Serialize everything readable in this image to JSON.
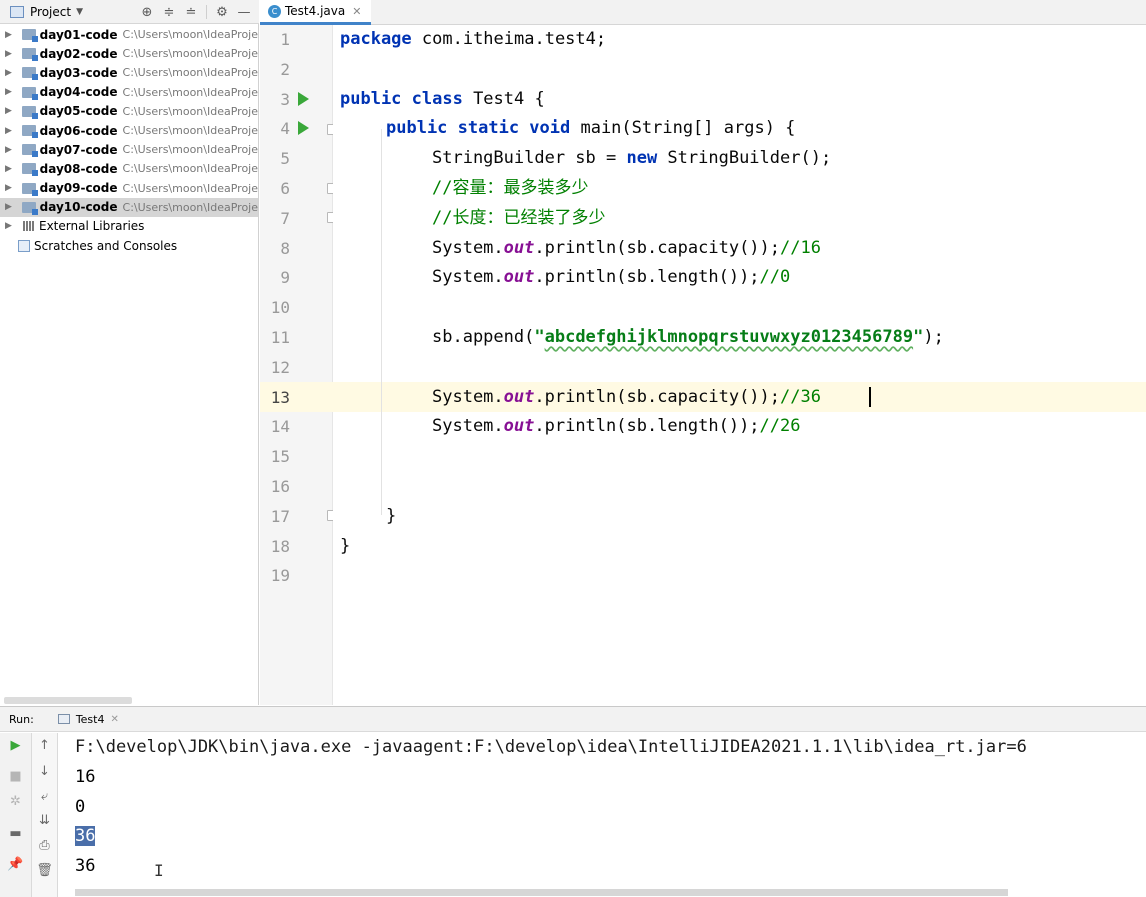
{
  "project_panel": {
    "title": "Project",
    "toolbar_icons": [
      "locate-icon",
      "expand-all-icon",
      "collapse-all-icon",
      "gear-icon",
      "hide-icon"
    ],
    "modules": [
      {
        "name": "day01-code",
        "path": "C:\\Users\\moon\\IdeaProje"
      },
      {
        "name": "day02-code",
        "path": "C:\\Users\\moon\\IdeaProje"
      },
      {
        "name": "day03-code",
        "path": "C:\\Users\\moon\\IdeaProje"
      },
      {
        "name": "day04-code",
        "path": "C:\\Users\\moon\\IdeaProje"
      },
      {
        "name": "day05-code",
        "path": "C:\\Users\\moon\\IdeaProje"
      },
      {
        "name": "day06-code",
        "path": "C:\\Users\\moon\\IdeaProje"
      },
      {
        "name": "day07-code",
        "path": "C:\\Users\\moon\\IdeaProje"
      },
      {
        "name": "day08-code",
        "path": "C:\\Users\\moon\\IdeaProje"
      },
      {
        "name": "day09-code",
        "path": "C:\\Users\\moon\\IdeaProje"
      },
      {
        "name": "day10-code",
        "path": "C:\\Users\\moon\\IdeaProje",
        "selected": true
      }
    ],
    "external_libraries": "External Libraries",
    "scratches": "Scratches and Consoles"
  },
  "editor": {
    "tab": "Test4.java",
    "line_numbers": [
      "1",
      "2",
      "3",
      "4",
      "5",
      "6",
      "7",
      "8",
      "9",
      "10",
      "11",
      "12",
      "13",
      "14",
      "15",
      "16",
      "17",
      "18",
      "19"
    ],
    "current_line": 13,
    "code": {
      "l1_kw": "package",
      "l1_rest": " com.itheima.test4;",
      "l3_kw": "public class",
      "l3_rest": " Test4 {",
      "l4_kw": "public static void",
      "l4_rest": " main(String[] args) {",
      "l5_a": "StringBuilder sb = ",
      "l5_kw": "new",
      "l5_b": " StringBuilder();",
      "l6": "//容量：最多装多少",
      "l7": "//长度：已经装了多少",
      "l8_a": "System.",
      "l8_out": "out",
      "l8_b": ".println(sb.capacity());",
      "l8_c": "//16",
      "l9_a": "System.",
      "l9_out": "out",
      "l9_b": ".println(sb.length());",
      "l9_c": "//0",
      "l11_a": "sb.append(",
      "l11_q1": "\"",
      "l11_str": "abcdefghijklmnopqrstuvwxyz0123456789",
      "l11_q2": "\"",
      "l11_b": ");",
      "l13_a": "System.",
      "l13_out": "out",
      "l13_b": ".println(sb.capacity());",
      "l13_c": "//36",
      "l14_a": "System.",
      "l14_out": "out",
      "l14_b": ".println(sb.length());",
      "l14_c": "//26",
      "l17": "}",
      "l18": "}"
    }
  },
  "run_panel": {
    "label": "Run:",
    "tab": "Test4",
    "toolbar_left": [
      "run-icon",
      "stop-icon",
      "debug-icon",
      "layout-icon",
      "pin-icon"
    ],
    "toolbar_right": [
      "up-arrow-icon",
      "down-arrow-icon",
      "soft-wrap-icon",
      "scroll-to-end-icon",
      "print-icon",
      "trash-icon"
    ],
    "console": {
      "command": "F:\\develop\\JDK\\bin\\java.exe -javaagent:F:\\develop\\idea\\IntelliJIDEA2021.1.1\\lib\\idea_rt.jar=6",
      "out1": "16",
      "out2": "0",
      "out3": "36",
      "out4": "36"
    }
  }
}
